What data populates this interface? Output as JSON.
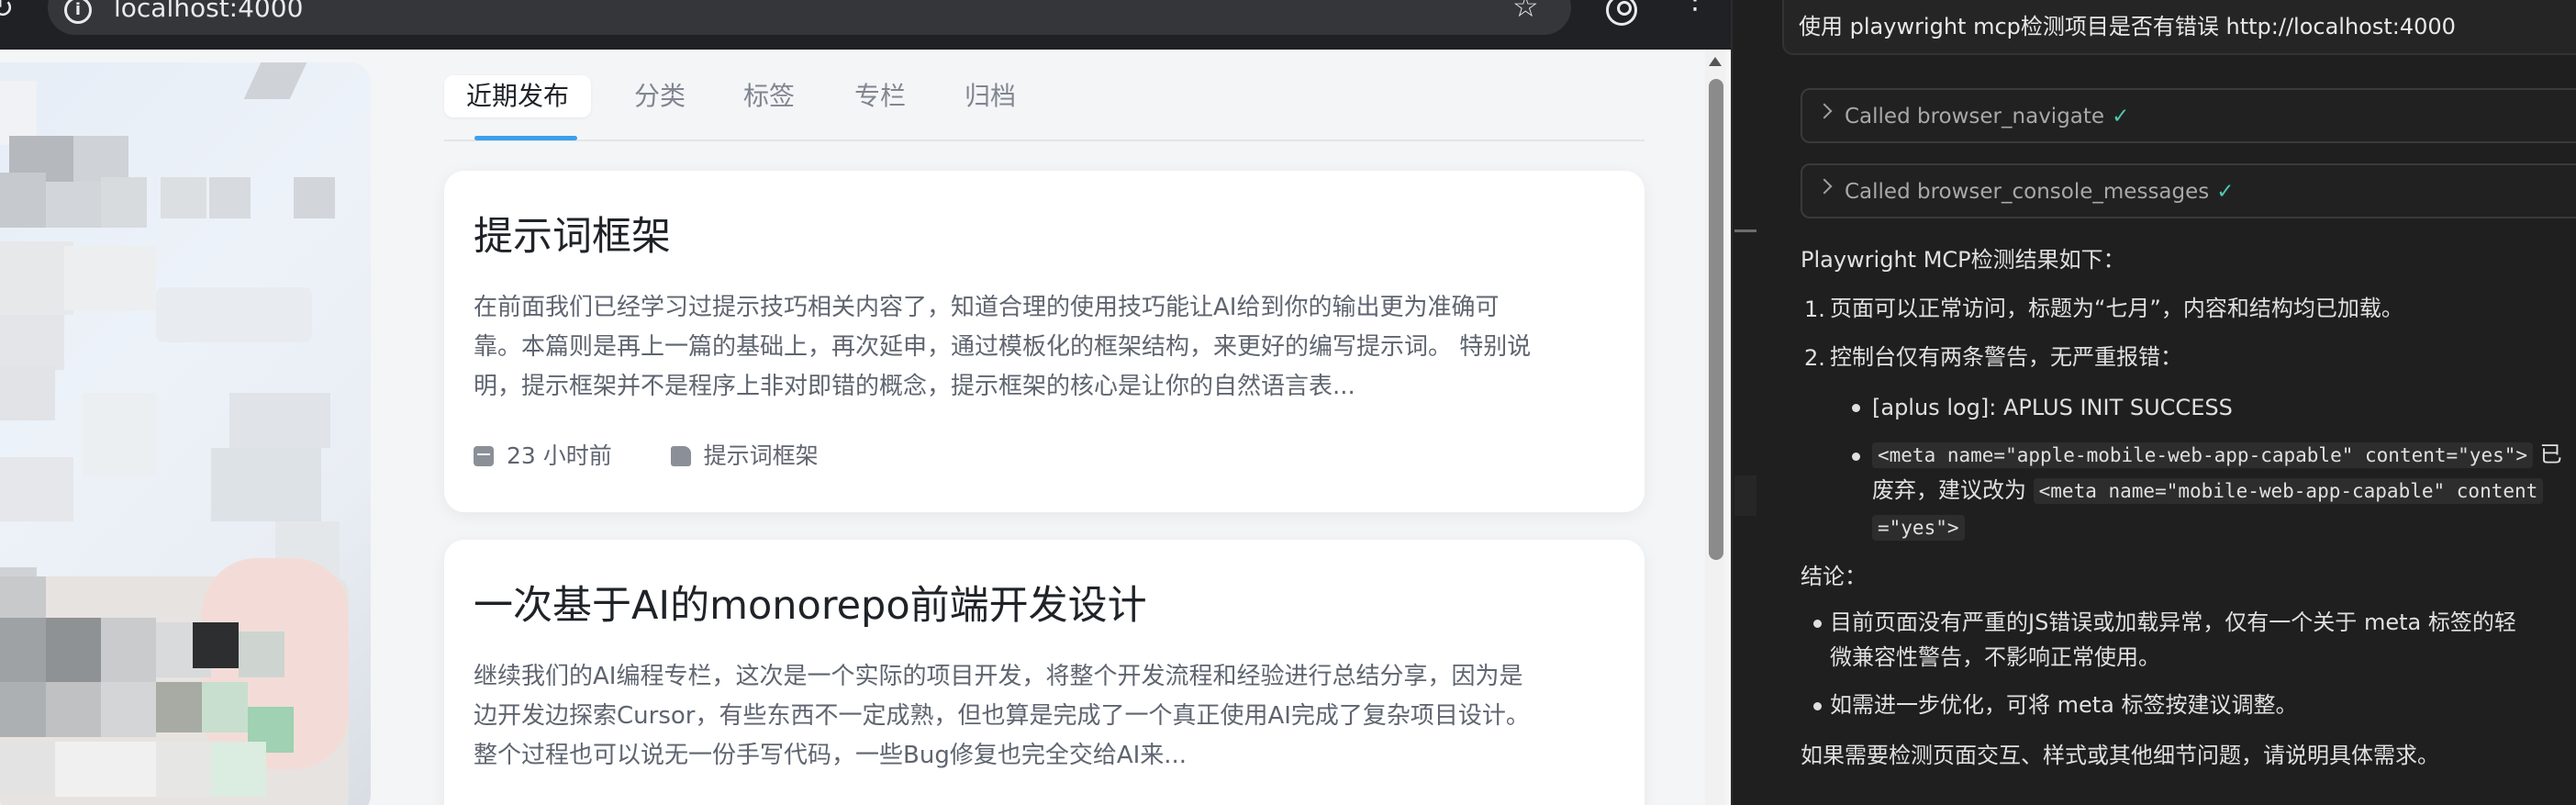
{
  "browser": {
    "url": "localhost:4000"
  },
  "tabs": [
    {
      "label": "近期发布",
      "active": true
    },
    {
      "label": "分类",
      "active": false
    },
    {
      "label": "标签",
      "active": false
    },
    {
      "label": "专栏",
      "active": false
    },
    {
      "label": "归档",
      "active": false
    }
  ],
  "posts": [
    {
      "title": "提示词框架",
      "excerpt_lines": [
        "在前面我们已经学习过提示技巧相关内容了，知道合理的使用技巧能让AI给到你的输出更为准确可",
        "靠。本篇则是再上一篇的基础上，再次延申，通过模板化的框架结构，来更好的编写提示词。 特别说",
        "明，提示框架并不是程序上非对即错的概念，提示框架的核心是让你的自然语言表..."
      ],
      "time": "23 小时前",
      "category": "提示词框架"
    },
    {
      "title": "一次基于AI的monorepo前端开发设计",
      "excerpt_lines": [
        "继续我们的AI编程专栏，这次是一个实际的项目开发，将整个开发流程和经验进行总结分享，因为是",
        "边开发边探索Cursor，有些东西不一定成熟，但也算是完成了一个真正使用AI完成了复杂项目设计。",
        "整个过程也可以说无一份手写代码，一些Bug修复也完全交给AI来..."
      ]
    }
  ],
  "chat": {
    "prompt": "使用 playwright mcp检测项目是否有错误 http://localhost:4000",
    "tool_calls": [
      {
        "label": "Called browser_navigate",
        "status": "✓"
      },
      {
        "label": "Called browser_console_messages",
        "status": "✓"
      }
    ],
    "heading": "Playwright MCP检测结果如下：",
    "item1": "页面可以正常访问，标题为“七月”，内容和结构均已加载。",
    "item2": "控制台仅有两条警告，无严重报错：",
    "warning1": "[aplus log]: APLUS INIT SUCCESS",
    "warning2_code1": "<meta name=\"apple-mobile-web-app-capable\" content=\"yes\">",
    "warning2_text1": "已",
    "warning2_text2": "废弃，建议改为",
    "warning2_code2": "<meta name=\"mobile-web-app-capable\" content",
    "warning2_code3": "=\"yes\">",
    "conclusion_label": "结论：",
    "conclusion1_line1": "目前页面没有严重的JS错误或加载异常，仅有一个关于 meta 标签的轻",
    "conclusion1_line2": "微兼容性警告，不影响正常使用。",
    "conclusion2": "如需进一步优化，可将 meta 标签按建议调整。",
    "footer": "如果需要检测页面交互、样式或其他细节问题，请说明具体需求。"
  },
  "colors": {
    "accent": "#3aa0ee",
    "check": "#4ec9b0"
  }
}
